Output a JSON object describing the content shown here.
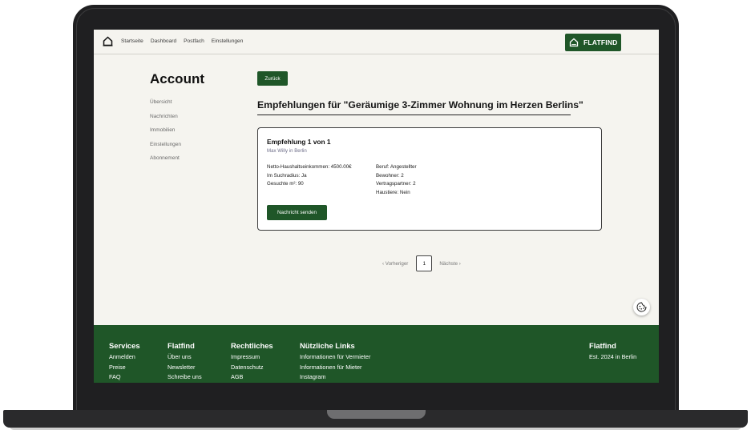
{
  "nav": {
    "links": [
      "Startseite",
      "Dashboard",
      "Postfach",
      "Einstellungen"
    ],
    "brand": "FLATFIND"
  },
  "account": {
    "title": "Account",
    "menu": [
      "Übersicht",
      "Nachrichten",
      "Immobilien",
      "Einstellungen",
      "Abonnement"
    ]
  },
  "main": {
    "back_label": "Zurück",
    "title": "Empfehlungen für \"Geräumige 3-Zimmer Wohnung im Herzen Berlins\""
  },
  "recommendation": {
    "title": "Empfehlung 1 von 1",
    "subtitle": "Max Willy in Berlin",
    "left_details": [
      "Netto-Haushaltseinkommen: 4500.00€",
      "Im Suchradius: Ja",
      "Gesuchte m²: 90"
    ],
    "right_details": [
      "Beruf: Angestellter",
      "Bewohner: 2",
      "Vertragspartner: 2",
      "Haustiere: Nein"
    ],
    "send_label": "Nachricht senden"
  },
  "pagination": {
    "prev": "‹ Vorheriger",
    "page": "1",
    "next": "Nächste ›"
  },
  "footer": {
    "services": {
      "heading": "Services",
      "items": [
        "Anmelden",
        "Preise",
        "FAQ"
      ]
    },
    "flatfind": {
      "heading": "Flatfind",
      "items": [
        "Über uns",
        "Newsletter",
        "Schreibe uns"
      ]
    },
    "legal": {
      "heading": "Rechtliches",
      "items": [
        "Impressum",
        "Datenschutz",
        "AGB"
      ]
    },
    "links": {
      "heading": "Nützliche Links",
      "items": [
        "Informationen für Vermieter",
        "Informationen für Mieter",
        "Instagram"
      ]
    },
    "brand": {
      "heading": "Flatfind",
      "tagline": "Est. 2024 in Berlin"
    }
  },
  "icons": {
    "home": "home-icon",
    "brand": "house-outline-icon",
    "cookie": "cookie-icon"
  },
  "colors": {
    "brand_green": "#1f5628",
    "screen_bg": "#f5f4ef"
  }
}
